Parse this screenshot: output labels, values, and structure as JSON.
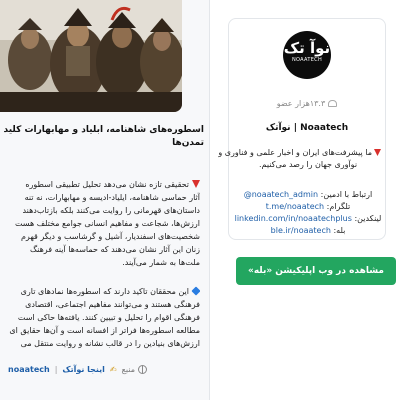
{
  "post": {
    "image_alt": "warriors illustration",
    "title_line1": "اسطوره‌های شاهنامه، ابلیاد و مهابهارات کلید فهم فره",
    "title_line2": "تمدن‌ها",
    "para1": [
      "تحقیقی تازه نشان می‌دهد تحلیل تطبیقی اسطوره",
      "آثار حماسی شاهنامه، ایلیاد-ادیسه و مهابهارات، نه تنه",
      "داستان‌های قهرمانی را روایت می‌کنند بلکه بازتاب‌دهند",
      "ارزش‌ها، شجاعت و مفاهیم انسانی جوامع مختلف هست",
      "شخصیت‌های اسفندیار، آشیل و گرشاسب و دیگر قهرم",
      "زنان این آثار نشان می‌دهند که حماسه‌ها آینه فرهنگ",
      "ملت‌ها به شمار می‌آیند."
    ],
    "para2": [
      "این محققان تاکید دارند که اسطوره‌ها نمادهای تاری",
      "فرهنگی هستند و می‌توانند مفاهیم اجتماعی، اقتصادی",
      "فرهنگی اقوام را تحلیل و تبیین کنند. یافته‌ها حاکی است",
      "مطالعه اسطوره‌ها فراتر از افسانه است و آن‌ها حقایق ای",
      "ارزش‌های بنیادین را در قالب نشانه و روایت منتقل می"
    ],
    "footer": {
      "source_label": "منبع",
      "source_link": "اینجا نوآتک",
      "channel_link": "noaatech"
    }
  },
  "channel": {
    "logo_mark": "نوآ تک",
    "logo_word": "NOAATECH",
    "members": "۱۳.۳هزار عضو",
    "name": "Noaatech | نوآتک",
    "desc_line1": "ما پیشرفت‌های ایران و اخبار علمی و فناوری و",
    "desc_line2": "نوآوری جهان را رصد می‌کنیم.",
    "contact": [
      {
        "label": "ارتباط با ادمین:",
        "value": "@noaatech_admin"
      },
      {
        "label": "تلگرام:",
        "value": "t.me/noaatech"
      },
      {
        "label": "لینکدین:",
        "value": "linkedin.com/in/noaatechplus"
      },
      {
        "label": "بله:",
        "value": "ble.ir/noaatech"
      }
    ]
  },
  "open_button": "مشاهده در وب اپلیکیشن «بله»",
  "colors": {
    "accent_green": "#23a660",
    "link_blue": "#1f5fa8",
    "bullet_red": "#d9302c",
    "bullet_blue": "#2a7de1"
  },
  "icons": [
    "globe-icon",
    "pen-icon",
    "users-icon",
    "red-triangle-icon",
    "blue-diamond-icon"
  ]
}
